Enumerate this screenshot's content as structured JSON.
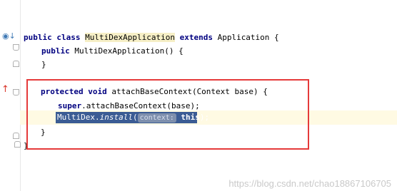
{
  "editor": {
    "line_class": {
      "kw1": "public",
      "kw2": "class",
      "name": "MultiDexApplication",
      "kw3": "extends",
      "rest": " Application {"
    },
    "line_ctor": {
      "kw": "public",
      "rest": " MultiDexApplication() {"
    },
    "line_ctor_close": "}",
    "line_attach": {
      "kw1": "protected",
      "kw2": "void",
      "rest": " attachBaseContext(Context base) {"
    },
    "line_super": {
      "kw": "super",
      "rest": ".attachBaseContext(base);"
    },
    "line_install": {
      "prefix": "MultiDex.",
      "method": "install",
      "open": "(",
      "hint": "context:",
      "arg": " this",
      "close": ");"
    },
    "line_attach_close": "}",
    "line_class_close": "}"
  },
  "gutter": {
    "implements_icon": "implements-icon",
    "override_icon": "override-arrow-icon"
  },
  "watermark": "https://blog.csdn.net/chao18867106705",
  "colors": {
    "keyword": "#000080",
    "selection": "#3b5c94",
    "highlight_box": "#e53a3a",
    "class_name_highlight": "#f6efc6"
  }
}
